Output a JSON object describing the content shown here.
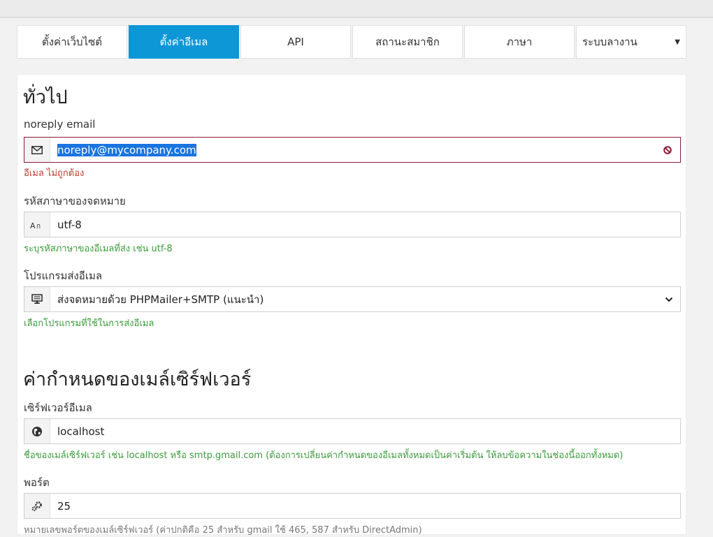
{
  "tabs": [
    {
      "label": "ตั้งค่าเว็บไซต์"
    },
    {
      "label": "ตั้งค่าอีเมล"
    },
    {
      "label": "API"
    },
    {
      "label": "สถานะสมาชิก"
    },
    {
      "label": "ภาษา"
    },
    {
      "label": "ระบบลางาน"
    }
  ],
  "active_tab": "ตั้งค่าอีเมล",
  "section_general": {
    "title": "ทั่วไป",
    "noreply": {
      "label": "noreply email",
      "value": "noreply@mycompany.com",
      "error": "อีเมล ไม่ถูกต้อง",
      "icon": "envelope-icon"
    },
    "charset": {
      "label": "รหัสภาษาของจดหมาย",
      "value": "utf-8",
      "hint": "ระบุรหัสภาษาของอีเมลที่ส่ง เช่น utf-8",
      "icon": "language-icon"
    },
    "mailer": {
      "label": "โปรแกรมส่งอีเมล",
      "value": "ส่งจดหมายด้วย PHPMailer+SMTP (แนะนำ)",
      "hint": "เลือกโปรแกรมที่ใช้ในการส่งอีเมล",
      "icon": "computer-icon"
    }
  },
  "section_server": {
    "title": "ค่ากำหนดของเมล์เซิร์ฟเวอร์",
    "host": {
      "label": "เซิร์ฟเวอร์อีเมล",
      "value": "localhost",
      "hint": "ชื่อของเมล์เซิร์ฟเวอร์ เช่น localhost หรือ smtp.gmail.com (ต้องการเปลี่ยนค่ากำหนดของอีเมลทั้งหมดเป็นค่าเริ่มต้น ให้ลบข้อความในช่องนี้ออกทั้งหมด)",
      "icon": "globe-icon"
    },
    "port": {
      "label": "พอร์ต",
      "value": "25",
      "hint": "หมายเลขพอร์ตของเมล์เซิร์ฟเวอร์ (ค่าปกติคือ 25 สำหรับ gmail ใช้ 465, 587 สำหรับ DirectAdmin)",
      "icon": "gears-icon"
    }
  },
  "colors": {
    "accent": "#0e97d6",
    "error_border": "#8b1a3a",
    "hint_green": "#3b9a3b",
    "error_text": "#c0392b"
  }
}
